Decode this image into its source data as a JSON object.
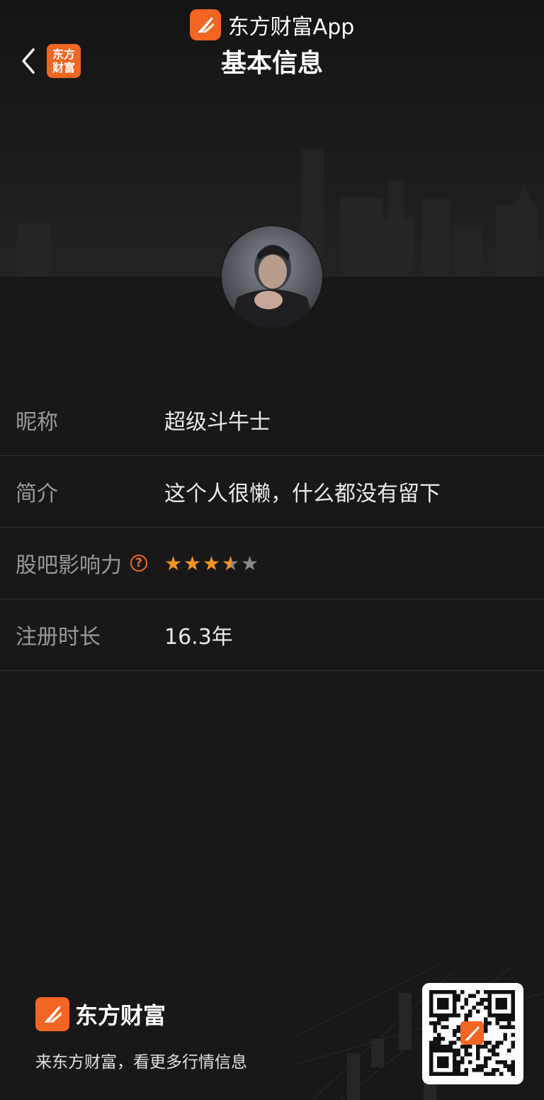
{
  "app_banner": {
    "text": "东方财富App",
    "icon": "eastmoney-logo-icon"
  },
  "header": {
    "back_icon": "chevron-left-icon",
    "mini_logo_line1": "东方",
    "mini_logo_line2": "财富",
    "title": "基本信息"
  },
  "profile": {
    "avatar": "user-avatar",
    "rows": [
      {
        "label": "昵称",
        "value": "超级斗牛士"
      },
      {
        "label": "简介",
        "value": "这个人很懒，什么都没有留下"
      },
      {
        "label": "股吧影响力",
        "help_icon": "?",
        "rating": 3.5,
        "rating_max": 5
      },
      {
        "label": "注册时长",
        "value": "16.3年"
      }
    ]
  },
  "footer": {
    "brand_name": "东方财富",
    "slogan": "来东方财富，看更多行情信息",
    "qr_icon": "qr-code-icon"
  },
  "colors": {
    "brand": "#f26522",
    "star": "#f29322",
    "background": "#181818"
  }
}
